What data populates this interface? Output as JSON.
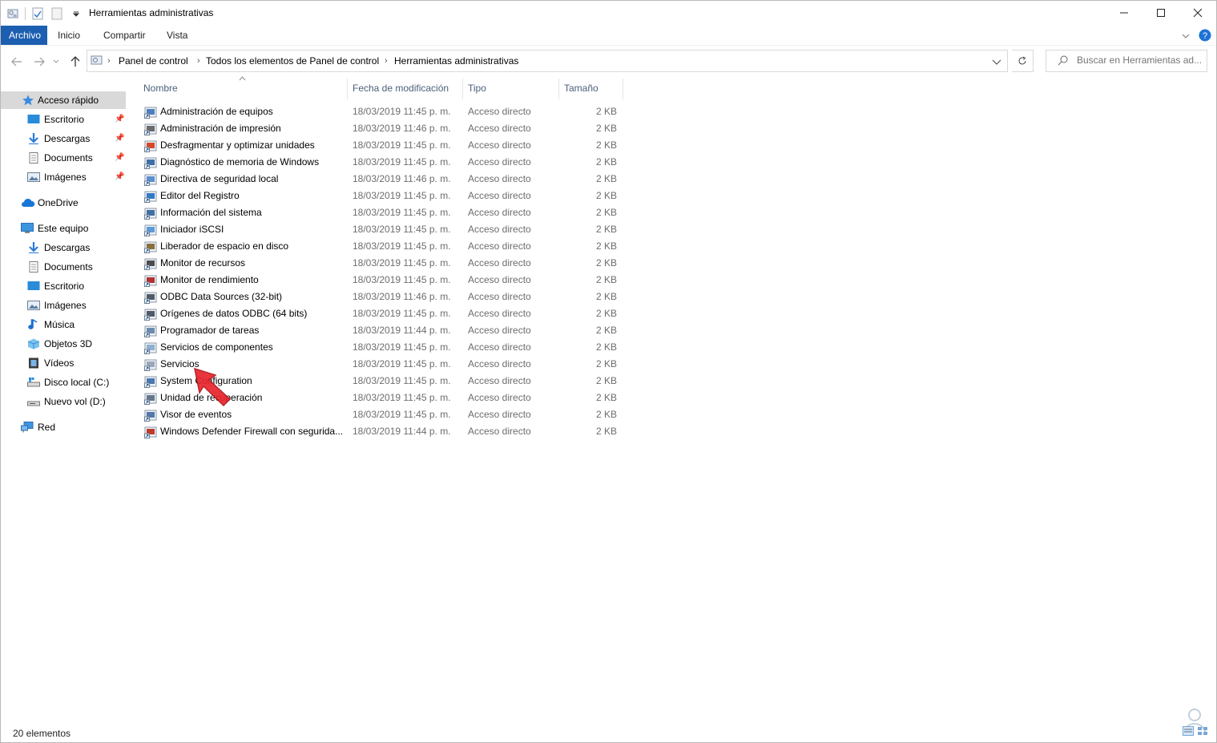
{
  "window": {
    "title": "Herramientas administrativas",
    "controls": [
      "minimize-icon",
      "maximize-icon",
      "close-icon"
    ]
  },
  "ribbon": {
    "tabs": [
      {
        "label": "Archivo",
        "active": true
      },
      {
        "label": "Inicio"
      },
      {
        "label": "Compartir"
      },
      {
        "label": "Vista"
      }
    ],
    "accent_color": "#1c5fb1"
  },
  "address": {
    "segments": [
      "Panel de control",
      "Todos los elementos de Panel de control",
      "Herramientas administrativas"
    ],
    "search_placeholder": "Buscar en Herramientas ad..."
  },
  "navpane": {
    "items": [
      {
        "label": "Acceso rápido",
        "icon": "star-icon",
        "selected": true
      },
      {
        "label": "Escritorio",
        "icon": "desktop-icon",
        "pinned": true
      },
      {
        "label": "Descargas",
        "icon": "download-icon",
        "pinned": true
      },
      {
        "label": "Documents",
        "icon": "document-icon",
        "pinned": true
      },
      {
        "label": "Imágenes",
        "icon": "pictures-icon",
        "pinned": true
      },
      {
        "label": "OneDrive",
        "icon": "cloud-icon"
      },
      {
        "label": "Este equipo",
        "icon": "computer-icon"
      },
      {
        "label": "Descargas",
        "icon": "download-icon"
      },
      {
        "label": "Documents",
        "icon": "document-icon"
      },
      {
        "label": "Escritorio",
        "icon": "desktop-icon"
      },
      {
        "label": "Imágenes",
        "icon": "pictures-icon"
      },
      {
        "label": "Música",
        "icon": "music-icon"
      },
      {
        "label": "Objetos 3D",
        "icon": "cube-icon"
      },
      {
        "label": "Vídeos",
        "icon": "video-icon"
      },
      {
        "label": "Disco local (C:)",
        "icon": "drive-icon"
      },
      {
        "label": "Nuevo vol (D:)",
        "icon": "drive-icon"
      },
      {
        "label": "Red",
        "icon": "network-icon"
      }
    ]
  },
  "filelist": {
    "columns": [
      "Nombre",
      "Fecha de modificación",
      "Tipo",
      "Tamaño"
    ],
    "rows": [
      {
        "name": "Administración de equipos",
        "date": "18/03/2019 11:45 p. m.",
        "type": "Acceso directo",
        "size": "2 KB"
      },
      {
        "name": "Administración de impresión",
        "date": "18/03/2019 11:46 p. m.",
        "type": "Acceso directo",
        "size": "2 KB"
      },
      {
        "name": "Desfragmentar y optimizar unidades",
        "date": "18/03/2019 11:45 p. m.",
        "type": "Acceso directo",
        "size": "2 KB"
      },
      {
        "name": "Diagnóstico de memoria de Windows",
        "date": "18/03/2019 11:45 p. m.",
        "type": "Acceso directo",
        "size": "2 KB"
      },
      {
        "name": "Directiva de seguridad local",
        "date": "18/03/2019 11:46 p. m.",
        "type": "Acceso directo",
        "size": "2 KB"
      },
      {
        "name": "Editor del Registro",
        "date": "18/03/2019 11:45 p. m.",
        "type": "Acceso directo",
        "size": "2 KB"
      },
      {
        "name": "Información del sistema",
        "date": "18/03/2019 11:45 p. m.",
        "type": "Acceso directo",
        "size": "2 KB"
      },
      {
        "name": "Iniciador iSCSI",
        "date": "18/03/2019 11:45 p. m.",
        "type": "Acceso directo",
        "size": "2 KB"
      },
      {
        "name": "Liberador de espacio en disco",
        "date": "18/03/2019 11:45 p. m.",
        "type": "Acceso directo",
        "size": "2 KB"
      },
      {
        "name": "Monitor de recursos",
        "date": "18/03/2019 11:45 p. m.",
        "type": "Acceso directo",
        "size": "2 KB"
      },
      {
        "name": "Monitor de rendimiento",
        "date": "18/03/2019 11:45 p. m.",
        "type": "Acceso directo",
        "size": "2 KB"
      },
      {
        "name": "ODBC Data Sources (32-bit)",
        "date": "18/03/2019 11:46 p. m.",
        "type": "Acceso directo",
        "size": "2 KB"
      },
      {
        "name": "Orígenes de datos ODBC (64 bits)",
        "date": "18/03/2019 11:45 p. m.",
        "type": "Acceso directo",
        "size": "2 KB"
      },
      {
        "name": "Programador de tareas",
        "date": "18/03/2019 11:44 p. m.",
        "type": "Acceso directo",
        "size": "2 KB"
      },
      {
        "name": "Servicios de componentes",
        "date": "18/03/2019 11:45 p. m.",
        "type": "Acceso directo",
        "size": "2 KB"
      },
      {
        "name": "Servicios",
        "date": "18/03/2019 11:45 p. m.",
        "type": "Acceso directo",
        "size": "2 KB"
      },
      {
        "name": "System Configuration",
        "date": "18/03/2019 11:45 p. m.",
        "type": "Acceso directo",
        "size": "2 KB"
      },
      {
        "name": "Unidad de recuperación",
        "date": "18/03/2019 11:45 p. m.",
        "type": "Acceso directo",
        "size": "2 KB"
      },
      {
        "name": "Visor de eventos",
        "date": "18/03/2019 11:45 p. m.",
        "type": "Acceso directo",
        "size": "2 KB"
      },
      {
        "name": "Windows Defender Firewall con segurida...",
        "date": "18/03/2019 11:44 p. m.",
        "type": "Acceso directo",
        "size": "2 KB"
      }
    ]
  },
  "status": {
    "count_text": "20 elementos"
  },
  "annotation": {
    "arrow_color": "#e8242c"
  }
}
